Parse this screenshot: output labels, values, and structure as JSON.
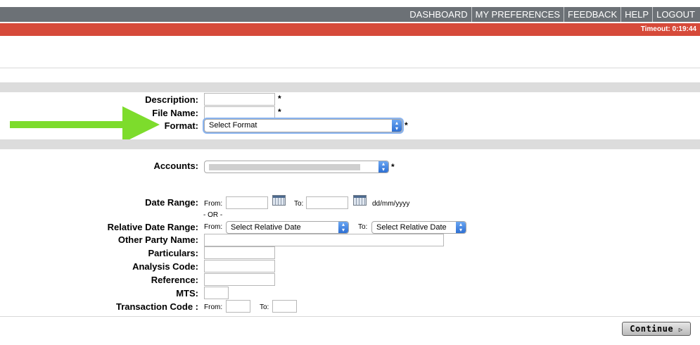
{
  "nav": {
    "links": [
      "DASHBOARD",
      "MY PREFERENCES",
      "FEEDBACK",
      "HELP",
      "LOGOUT"
    ]
  },
  "status": {
    "timeout": "Timeout: 0:19:44"
  },
  "form": {
    "description_label": "Description:",
    "filename_label": "File Name:",
    "format_label": "Format:",
    "format_value": "Select Format",
    "required_mark": "*",
    "accounts_label": "Accounts:",
    "date_range_label": "Date Range:",
    "from_label": "From:",
    "to_label": "To:",
    "date_format_hint": "dd/mm/yyyy",
    "or_text": "- OR -",
    "relative_label": "Relative Date Range:",
    "relative_from_value": "Select Relative Date",
    "relative_to_value": "Select Relative Date",
    "other_party_label": "Other Party Name:",
    "particulars_label": "Particulars:",
    "analysis_label": "Analysis Code:",
    "reference_label": "Reference:",
    "mts_label": "MTS:",
    "transaction_label": "Transaction Code :"
  },
  "actions": {
    "continue_label": "Continue"
  },
  "colors": {
    "nav_bg": "#6c7176",
    "alert_bar": "#d64a3a",
    "arrow": "#7ddc2c"
  },
  "icons": {
    "arrow": "right-arrow-icon",
    "calendar": "calendar-icon",
    "select": "chevron-updown-icon"
  }
}
